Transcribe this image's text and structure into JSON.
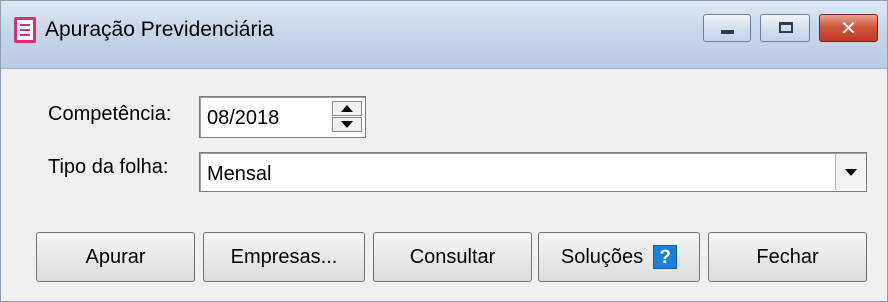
{
  "window": {
    "title": "Apuração Previdenciária",
    "icon": "document-icon",
    "controls": {
      "minimize": "minimize-icon",
      "maximize": "maximize-icon",
      "close": "close-icon"
    },
    "close_glyph": "✕"
  },
  "form": {
    "competencia": {
      "label": "Competência:",
      "value": "08/2018"
    },
    "tipo_folha": {
      "label": "Tipo da folha:",
      "value": "Mensal"
    }
  },
  "buttons": {
    "apurar": "Apurar",
    "empresas": "Empresas...",
    "consultar": "Consultar",
    "solucoes": "Soluções",
    "solucoes_icon": "?",
    "fechar": "Fechar"
  },
  "colors": {
    "close_button": "#c13a22",
    "app_icon": "#d6307a",
    "help_icon": "#1e7fd6"
  }
}
